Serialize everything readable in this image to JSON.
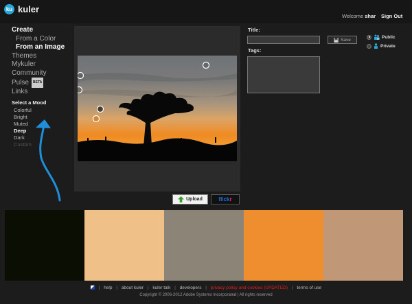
{
  "app": {
    "logo_badge": "ku",
    "name": "kuler"
  },
  "header": {
    "welcome_prefix": "Welcome",
    "username": "shar",
    "sign_out": "Sign Out"
  },
  "nav": {
    "create": "Create",
    "from_color": "From a Color",
    "from_image": "From an Image",
    "themes": "Themes",
    "mykuler": "Mykuler",
    "community": "Community",
    "pulse": "Pulse",
    "pulse_badge": "BETA",
    "links": "Links"
  },
  "mood": {
    "title": "Select a Mood",
    "items": [
      "Colorful",
      "Bright",
      "Muted",
      "Deep",
      "Dark",
      "Custom"
    ],
    "selected": "Deep"
  },
  "form": {
    "title_label": "Title:",
    "title_value": "",
    "tags_label": "Tags:",
    "tags_value": "",
    "save_label": "Save",
    "public_label": "Public",
    "private_label": "Private",
    "visibility": "Public"
  },
  "buttons": {
    "upload": "Upload",
    "flickr_a": "flick",
    "flickr_b": "r"
  },
  "swatches": [
    "#0b0f03",
    "#efc188",
    "#8b8477",
    "#ef8e2f",
    "#c09877"
  ],
  "footer": {
    "links": [
      "help",
      "about kuler",
      "kuler talk",
      "developers",
      "privacy policy and cookies (UPDATED)",
      "terms of use"
    ],
    "copyright": "Copyright © 2006-2012 Adobe Systems Incorporated | All rights reserved"
  }
}
